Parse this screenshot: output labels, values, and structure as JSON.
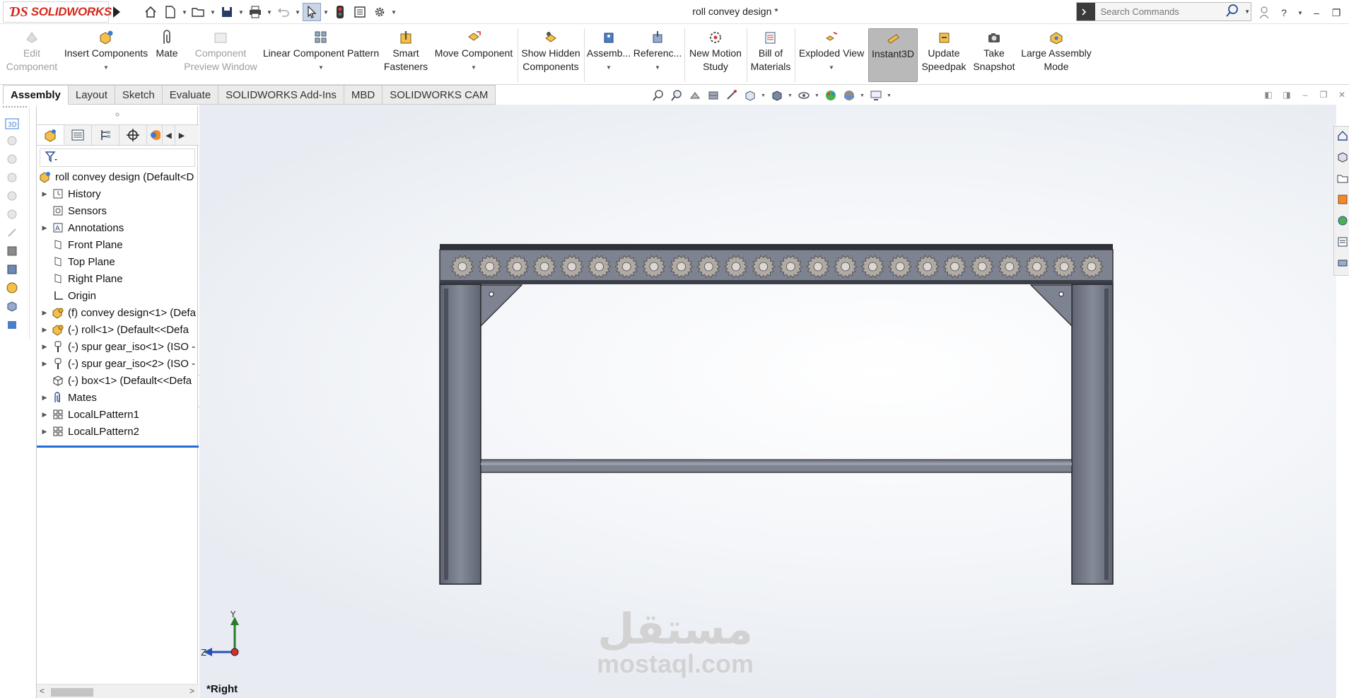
{
  "app": {
    "brand": "SOLIDWORKS",
    "document_title": "roll convey design *"
  },
  "search": {
    "placeholder": "Search Commands"
  },
  "ribbon": {
    "edit_component": [
      "Edit",
      "Component"
    ],
    "insert_components": "Insert Components",
    "mate": "Mate",
    "component_preview_window": [
      "Component",
      "Preview Window"
    ],
    "linear_component_pattern": "Linear Component Pattern",
    "smart_fasteners": [
      "Smart",
      "Fasteners"
    ],
    "move_component": "Move Component",
    "show_hidden_components": [
      "Show Hidden",
      "Components"
    ],
    "assembly": "Assemb...",
    "reference": "Referenc...",
    "new_motion_study": [
      "New Motion",
      "Study"
    ],
    "bill_of_materials": [
      "Bill of",
      "Materials"
    ],
    "exploded_view": "Exploded View",
    "instant3d": "Instant3D",
    "update_speedpak": [
      "Update",
      "Speedpak"
    ],
    "take_snapshot": [
      "Take",
      "Snapshot"
    ],
    "large_assembly_mode": [
      "Large Assembly",
      "Mode"
    ]
  },
  "tabs": [
    "Assembly",
    "Layout",
    "Sketch",
    "Evaluate",
    "SOLIDWORKS Add-Ins",
    "MBD",
    "SOLIDWORKS CAM"
  ],
  "active_tab": "Assembly",
  "tree": {
    "root": "roll convey design  (Default<D",
    "items": [
      {
        "label": "History",
        "expandable": true,
        "icon": "history-icon"
      },
      {
        "label": "Sensors",
        "expandable": false,
        "icon": "sensor-icon"
      },
      {
        "label": "Annotations",
        "expandable": true,
        "icon": "annotations-icon"
      },
      {
        "label": "Front Plane",
        "expandable": false,
        "icon": "plane-icon"
      },
      {
        "label": "Top Plane",
        "expandable": false,
        "icon": "plane-icon"
      },
      {
        "label": "Right Plane",
        "expandable": false,
        "icon": "plane-icon"
      },
      {
        "label": "Origin",
        "expandable": false,
        "icon": "origin-icon"
      },
      {
        "label": "(f) convey design<1> (Defa",
        "expandable": true,
        "icon": "subassembly-icon"
      },
      {
        "label": "(-) roll<1> (Default<<Defa",
        "expandable": true,
        "icon": "subassembly-icon"
      },
      {
        "label": "(-) spur gear_iso<1> (ISO -",
        "expandable": true,
        "icon": "toolbox-part-icon"
      },
      {
        "label": "(-) spur gear_iso<2> (ISO -",
        "expandable": true,
        "icon": "toolbox-part-icon"
      },
      {
        "label": "(-) box<1> (Default<<Defa",
        "expandable": false,
        "icon": "part-icon"
      },
      {
        "label": "Mates",
        "expandable": true,
        "icon": "mates-icon"
      },
      {
        "label": "LocalLPattern1",
        "expandable": true,
        "icon": "pattern-icon"
      },
      {
        "label": "LocalLPattern2",
        "expandable": true,
        "icon": "pattern-icon"
      }
    ]
  },
  "viewport": {
    "view_name": "*Right",
    "triad": {
      "y": "Y",
      "z": "Z"
    },
    "watermark": {
      "arabic": "مستقل",
      "latin": "mostaql.com"
    },
    "gear_count": 24
  },
  "colors": {
    "brand_red": "#d52b1e",
    "frame_fill": "#7e8391",
    "gear_fill": "#b0aaa5",
    "active_tab_accent": "#1f6fd6"
  }
}
